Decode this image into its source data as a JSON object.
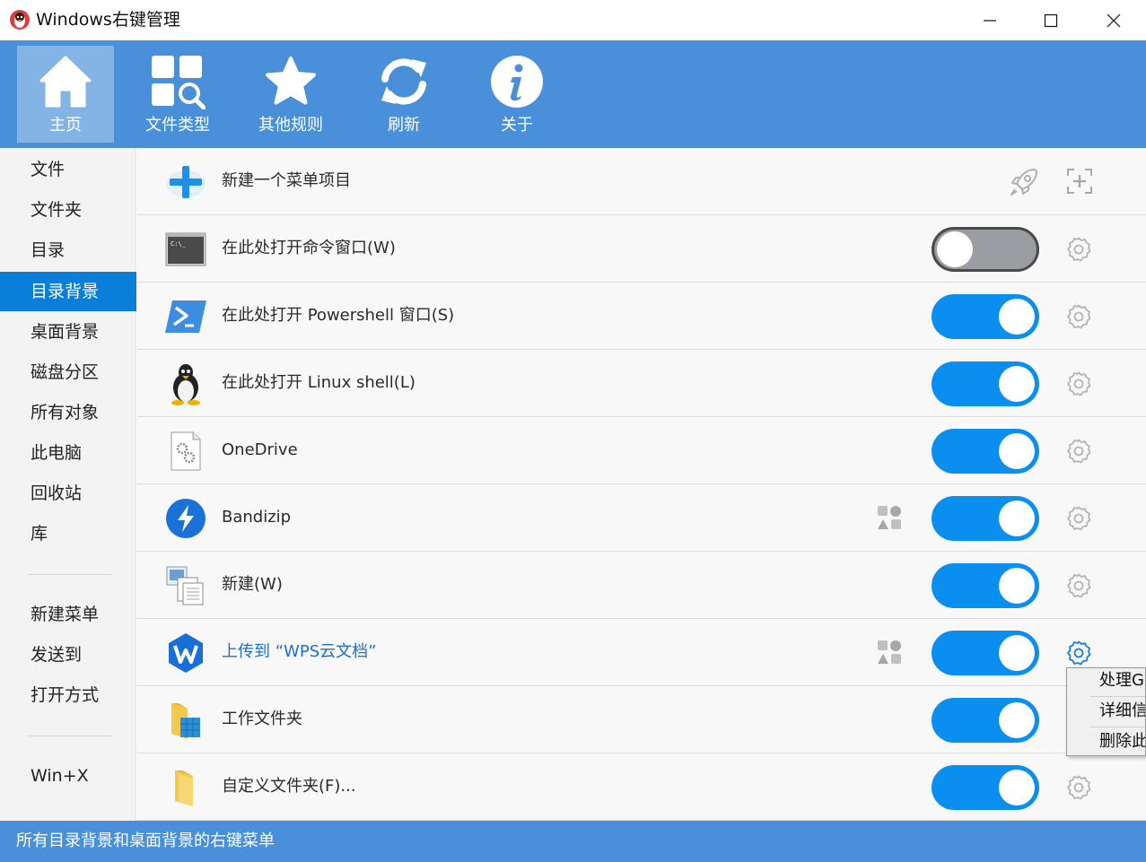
{
  "window": {
    "title": "Windows右键管理",
    "min_glyph": "—",
    "max_glyph": "☐",
    "close_glyph": "✕"
  },
  "toolbar": {
    "items": [
      {
        "label": "主页",
        "icon": "home-icon",
        "active": true
      },
      {
        "label": "文件类型",
        "icon": "file-types-icon",
        "active": false
      },
      {
        "label": "其他规则",
        "icon": "star-icon",
        "active": false
      },
      {
        "label": "刷新",
        "icon": "refresh-icon",
        "active": false
      },
      {
        "label": "关于",
        "icon": "info-icon",
        "active": false
      }
    ]
  },
  "sidebar": {
    "items": [
      {
        "label": "文件",
        "active": false
      },
      {
        "label": "文件夹",
        "active": false
      },
      {
        "label": "目录",
        "active": false
      },
      {
        "label": "目录背景",
        "active": true
      },
      {
        "label": "桌面背景",
        "active": false
      },
      {
        "label": "磁盘分区",
        "active": false
      },
      {
        "label": "所有对象",
        "active": false
      },
      {
        "label": "此电脑",
        "active": false
      },
      {
        "label": "回收站",
        "active": false
      },
      {
        "label": "库",
        "active": false
      }
    ],
    "group2": [
      {
        "label": "新建菜单"
      },
      {
        "label": "发送到"
      },
      {
        "label": "打开方式"
      }
    ],
    "group3": [
      {
        "label": "Win+X"
      }
    ]
  },
  "list": {
    "new_item_label": "新建一个菜单项目",
    "rows": [
      {
        "label": "在此处打开命令窗口(W)",
        "icon": "cmd-icon",
        "enabled": false
      },
      {
        "label": "在此处打开 Powershell 窗口(S)",
        "icon": "powershell-icon",
        "enabled": true
      },
      {
        "label": "在此处打开 Linux shell(L)",
        "icon": "linux-penguin-icon",
        "enabled": true
      },
      {
        "label": "OneDrive",
        "icon": "settings-file-icon",
        "enabled": true
      },
      {
        "label": "Bandizip",
        "icon": "bandizip-icon",
        "enabled": true
      },
      {
        "label": "新建(W)",
        "icon": "new-documents-icon",
        "enabled": true
      },
      {
        "label": "上传到 “WPS云文档”",
        "icon": "wps-icon",
        "enabled": true
      },
      {
        "label": "工作文件夹",
        "icon": "work-folder-icon",
        "enabled": true
      },
      {
        "label": "自定义文件夹(F)...",
        "icon": "folder-icon",
        "enabled": true
      }
    ]
  },
  "context_menu": {
    "items": [
      "处理GUID",
      "详细信息",
      "删除此项"
    ]
  },
  "status": {
    "text": "所有目录背景和桌面背景的右键菜单"
  },
  "colors": {
    "accent": "#4a8fd9",
    "toggle_on": "#0a8ff0",
    "toggle_off": "#9a9ea3",
    "sidebar_active": "#0a7fd9"
  }
}
